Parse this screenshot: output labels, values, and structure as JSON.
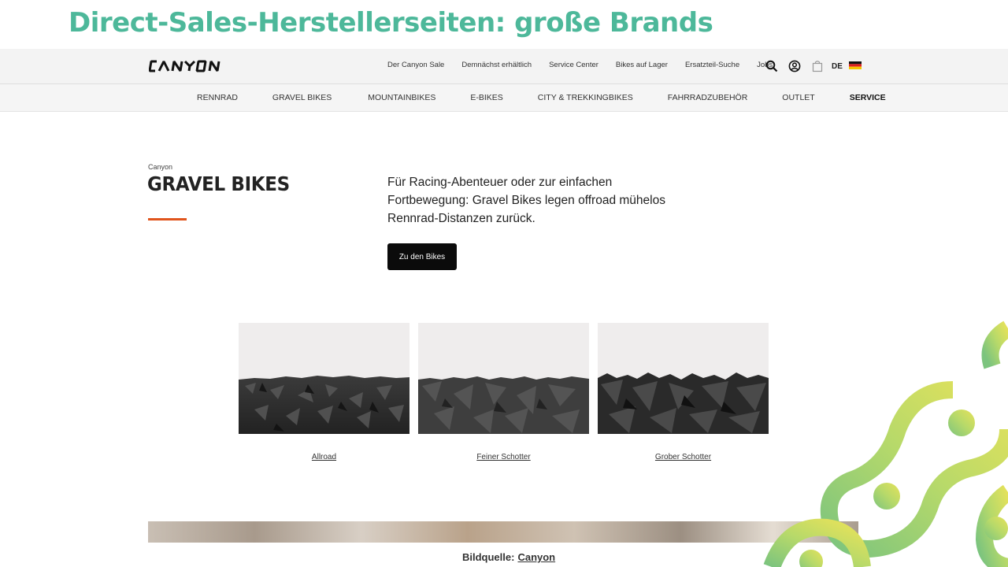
{
  "slide": {
    "title": "Direct-Sales-Herstellerseiten:  große Brands",
    "caption_label": "Bildquelle:",
    "caption_source": "Canyon"
  },
  "header": {
    "logo": "CANYON",
    "links": [
      "Der Canyon Sale",
      "Demnächst erhältlich",
      "Service Center",
      "Bikes auf Lager",
      "Ersatzteil-Suche",
      "Jobs"
    ],
    "language": "DE",
    "icons": [
      "search-icon",
      "account-icon",
      "cart-icon",
      "flag-de-icon"
    ]
  },
  "nav": {
    "items": [
      "RENNRAD",
      "GRAVEL BIKES",
      "MOUNTAINBIKES",
      "E-BIKES",
      "CITY & TREKKINGBIKES",
      "FAHRRADZUBEHÖR",
      "OUTLET",
      "SERVICE"
    ]
  },
  "hero": {
    "kicker": "Canyon",
    "title": "GRAVEL BIKES",
    "text": "Für Racing-Abenteuer oder zur einfachen Fortbewegung: Gravel Bikes legen offroad mühelos Rennrad-Distanzen zurück.",
    "cta": "Zu den Bikes"
  },
  "terrain": [
    {
      "label": "Allroad"
    },
    {
      "label": "Feiner Schotter"
    },
    {
      "label": "Grober Schotter"
    }
  ],
  "colors": {
    "title": "#4db89a",
    "accent": "#e0541c",
    "button": "#0b0b0b",
    "chain_yellow": "#e6e25a",
    "chain_green": "#7cc47e"
  }
}
